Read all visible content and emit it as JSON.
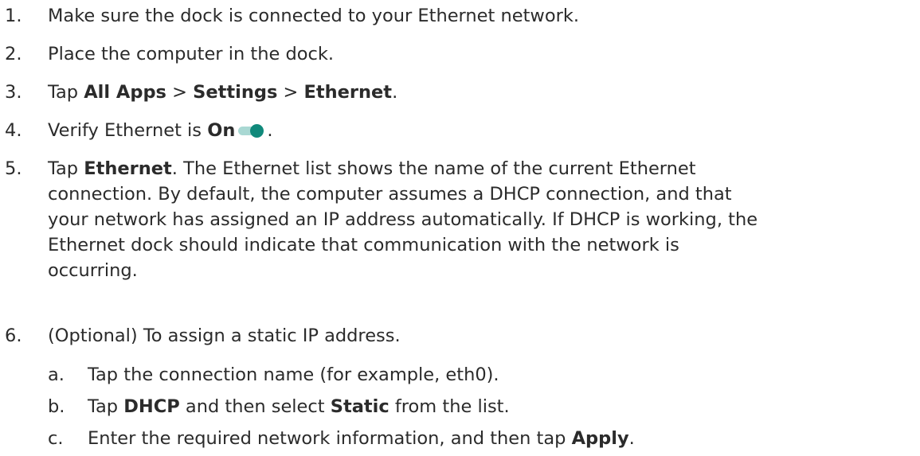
{
  "steps": [
    {
      "num": "1.",
      "parts": [
        "Make sure the dock is connected to your Ethernet network."
      ]
    },
    {
      "num": "2.",
      "parts": [
        "Place the computer in the dock."
      ]
    },
    {
      "num": "3.",
      "parts": [
        "Tap ",
        "All Apps",
        " > ",
        "Settings",
        " > ",
        "Ethernet",
        "."
      ]
    },
    {
      "num": "4.",
      "parts": [
        "Verify Ethernet is ",
        "On",
        "."
      ],
      "toggle": {
        "state": "on",
        "accent": "#10897b",
        "track": "#a9d8d3"
      }
    },
    {
      "num": "5.",
      "parts": [
        "Tap ",
        "Ethernet",
        ". The Ethernet list shows the name of the current Ethernet",
        "connection. By default, the computer assumes a DHCP connection, and that",
        "your network has assigned an IP address automatically. If DHCP is working, the",
        "Ethernet dock should indicate that communication with the network is",
        "occurring."
      ]
    },
    {
      "num": "6.",
      "parts": [
        "(Optional) To assign a static IP address."
      ]
    }
  ],
  "substeps": [
    {
      "letter": "a.",
      "parts": [
        "Tap the connection name (for example, eth0)."
      ]
    },
    {
      "letter": "b.",
      "parts": [
        "Tap ",
        "DHCP",
        " and then select ",
        "Static",
        " from the list."
      ]
    },
    {
      "letter": "c.",
      "parts": [
        "Enter the required network information, and then tap ",
        "Apply",
        "."
      ]
    }
  ]
}
